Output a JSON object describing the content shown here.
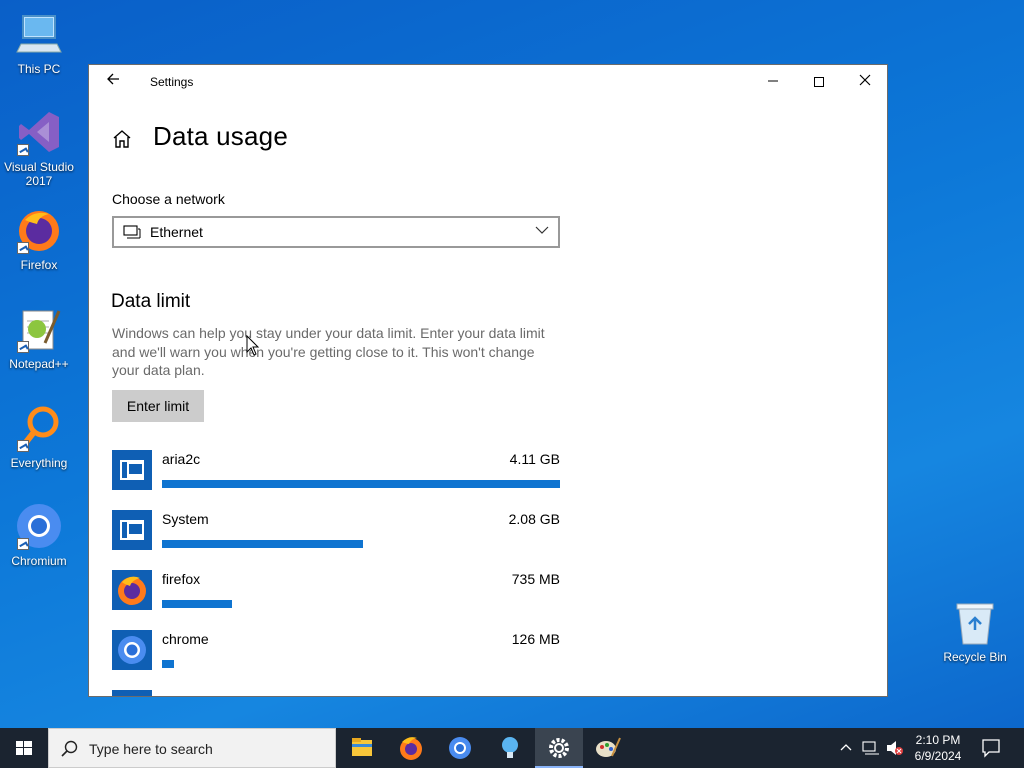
{
  "desktop": {
    "icons": [
      {
        "label": "This PC"
      },
      {
        "label": "Visual Studio 2017"
      },
      {
        "label": "Firefox"
      },
      {
        "label": "Notepad++"
      },
      {
        "label": "Everything"
      },
      {
        "label": "Chromium"
      }
    ],
    "recycle_bin": "Recycle Bin"
  },
  "window": {
    "title": "Settings",
    "page_title": "Data usage",
    "network_label": "Choose a network",
    "network_value": "Ethernet",
    "data_limit_title": "Data limit",
    "data_limit_desc": "Windows can help you stay under your data limit. Enter your data limit and we'll warn you when you're getting close to it. This won't change your data plan.",
    "enter_limit_label": "Enter limit",
    "apps": [
      {
        "name": "aria2c",
        "size": "4.11 GB",
        "fraction": 1.0
      },
      {
        "name": "System",
        "size": "2.08 GB",
        "fraction": 0.506
      },
      {
        "name": "firefox",
        "size": "735 MB",
        "fraction": 0.176
      },
      {
        "name": "chrome",
        "size": "126 MB",
        "fraction": 0.03
      }
    ]
  },
  "taskbar": {
    "search_placeholder": "Type here to search",
    "time": "2:10 PM",
    "date": "6/9/2024"
  },
  "colors": {
    "accent": "#0f74d0",
    "desktop": "#0d78d8",
    "taskbar": "#1b2430"
  }
}
